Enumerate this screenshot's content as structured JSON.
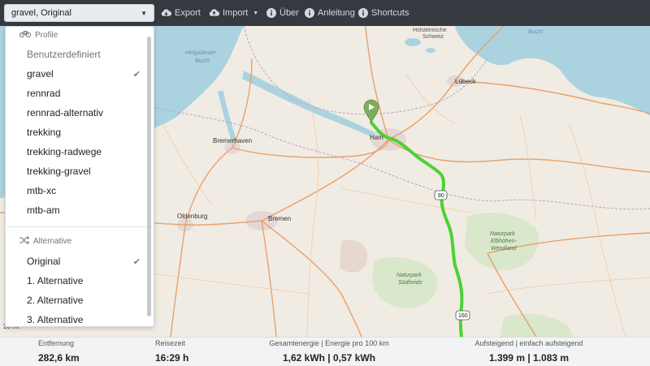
{
  "toolbar": {
    "profile_select": "gravel, Original",
    "export": "Export",
    "import": "Import",
    "about": "Über",
    "manual": "Anleitung",
    "shortcuts": "Shortcuts"
  },
  "dropdown": {
    "profiles_header": "Profile",
    "profiles": [
      {
        "label": "Benutzerdefiniert",
        "muted": true,
        "checked": false
      },
      {
        "label": "gravel",
        "muted": false,
        "checked": true
      },
      {
        "label": "rennrad",
        "muted": false,
        "checked": false
      },
      {
        "label": "rennrad-alternativ",
        "muted": false,
        "checked": false
      },
      {
        "label": "trekking",
        "muted": false,
        "checked": false
      },
      {
        "label": "trekking-radwege",
        "muted": false,
        "checked": false
      },
      {
        "label": "trekking-gravel",
        "muted": false,
        "checked": false
      },
      {
        "label": "mtb-xc",
        "muted": false,
        "checked": false
      },
      {
        "label": "mtb-am",
        "muted": false,
        "checked": false
      }
    ],
    "alternative_header": "Alternative",
    "alternatives": [
      {
        "label": "Original",
        "checked": true
      },
      {
        "label": "1. Alternative",
        "checked": false
      },
      {
        "label": "2. Alternative",
        "checked": false
      },
      {
        "label": "3. Alternative",
        "checked": false
      }
    ],
    "check_glyph": "✔"
  },
  "map": {
    "labels": {
      "sea1": "Helgoländer",
      "sea2": "Bucht",
      "holstein1": "Holsteinische",
      "holstein2": "Schweiz",
      "bucht": "Bucht",
      "luebeck": "Lübeck",
      "bremerhaven": "Bremerhaven",
      "hamburg": "Ham",
      "oldenburg": "Oldenburg",
      "bremen": "Bremen",
      "park_elbe1": "Naturpark",
      "park_elbe2": "Elbhöhen-",
      "park_elbe3": "Wendland",
      "park_sued1": "Naturpark",
      "park_sued2": "Südheide",
      "road_80": "80",
      "road_160": "160"
    },
    "scale": "20 mi",
    "route_color": "#4cd137",
    "marker_color": "#7fae5a"
  },
  "stats": {
    "distance_label": "Entfernung",
    "distance_value": "282,6 km",
    "time_label": "Reisezeit",
    "time_value": "16:29 h",
    "energy_label": "Gesamtenergie | Energie pro 100 km",
    "energy_value": "1,62 kWh | 0,57 kWh",
    "ascent_label": "Aufsteigend | einfach aufsteigend",
    "ascent_value": "1.399 m | 1.083 m"
  }
}
